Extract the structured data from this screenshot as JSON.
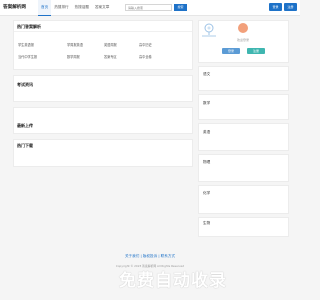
{
  "header": {
    "logo": "答案解析网",
    "nav": [
      "首页",
      "热搜排行",
      "热搜话题",
      "答案文章"
    ],
    "search_placeholder": "请输入搜索",
    "search_button": "搜索",
    "login": "登录",
    "register": "注册"
  },
  "panels": {
    "hot_answers": {
      "title": "热门答案解析",
      "links": [
        "学生英语报",
        "学周报英语",
        "英语周报",
        "高中历史",
        "当代中学生报",
        "数学周报",
        "答案专区",
        "高中全卷"
      ]
    },
    "exam_news": {
      "title": "考试资讯"
    },
    "latest_uploads": {
      "title": "最新上传"
    },
    "hot_downloads": {
      "title": "热门下载"
    }
  },
  "sidebar": {
    "user": {
      "prompt": "欢迎登录",
      "login": "登录",
      "register": "注册"
    },
    "subjects": [
      "语文",
      "数学",
      "英语",
      "物理",
      "化学",
      "生物"
    ]
  },
  "footer": {
    "links": "关于我们 | 版权投诉 | 联系方式",
    "copyright": "Copyright © 2023 答案解析网 All Rights Reserved",
    "watermark": "免费自动收录"
  }
}
